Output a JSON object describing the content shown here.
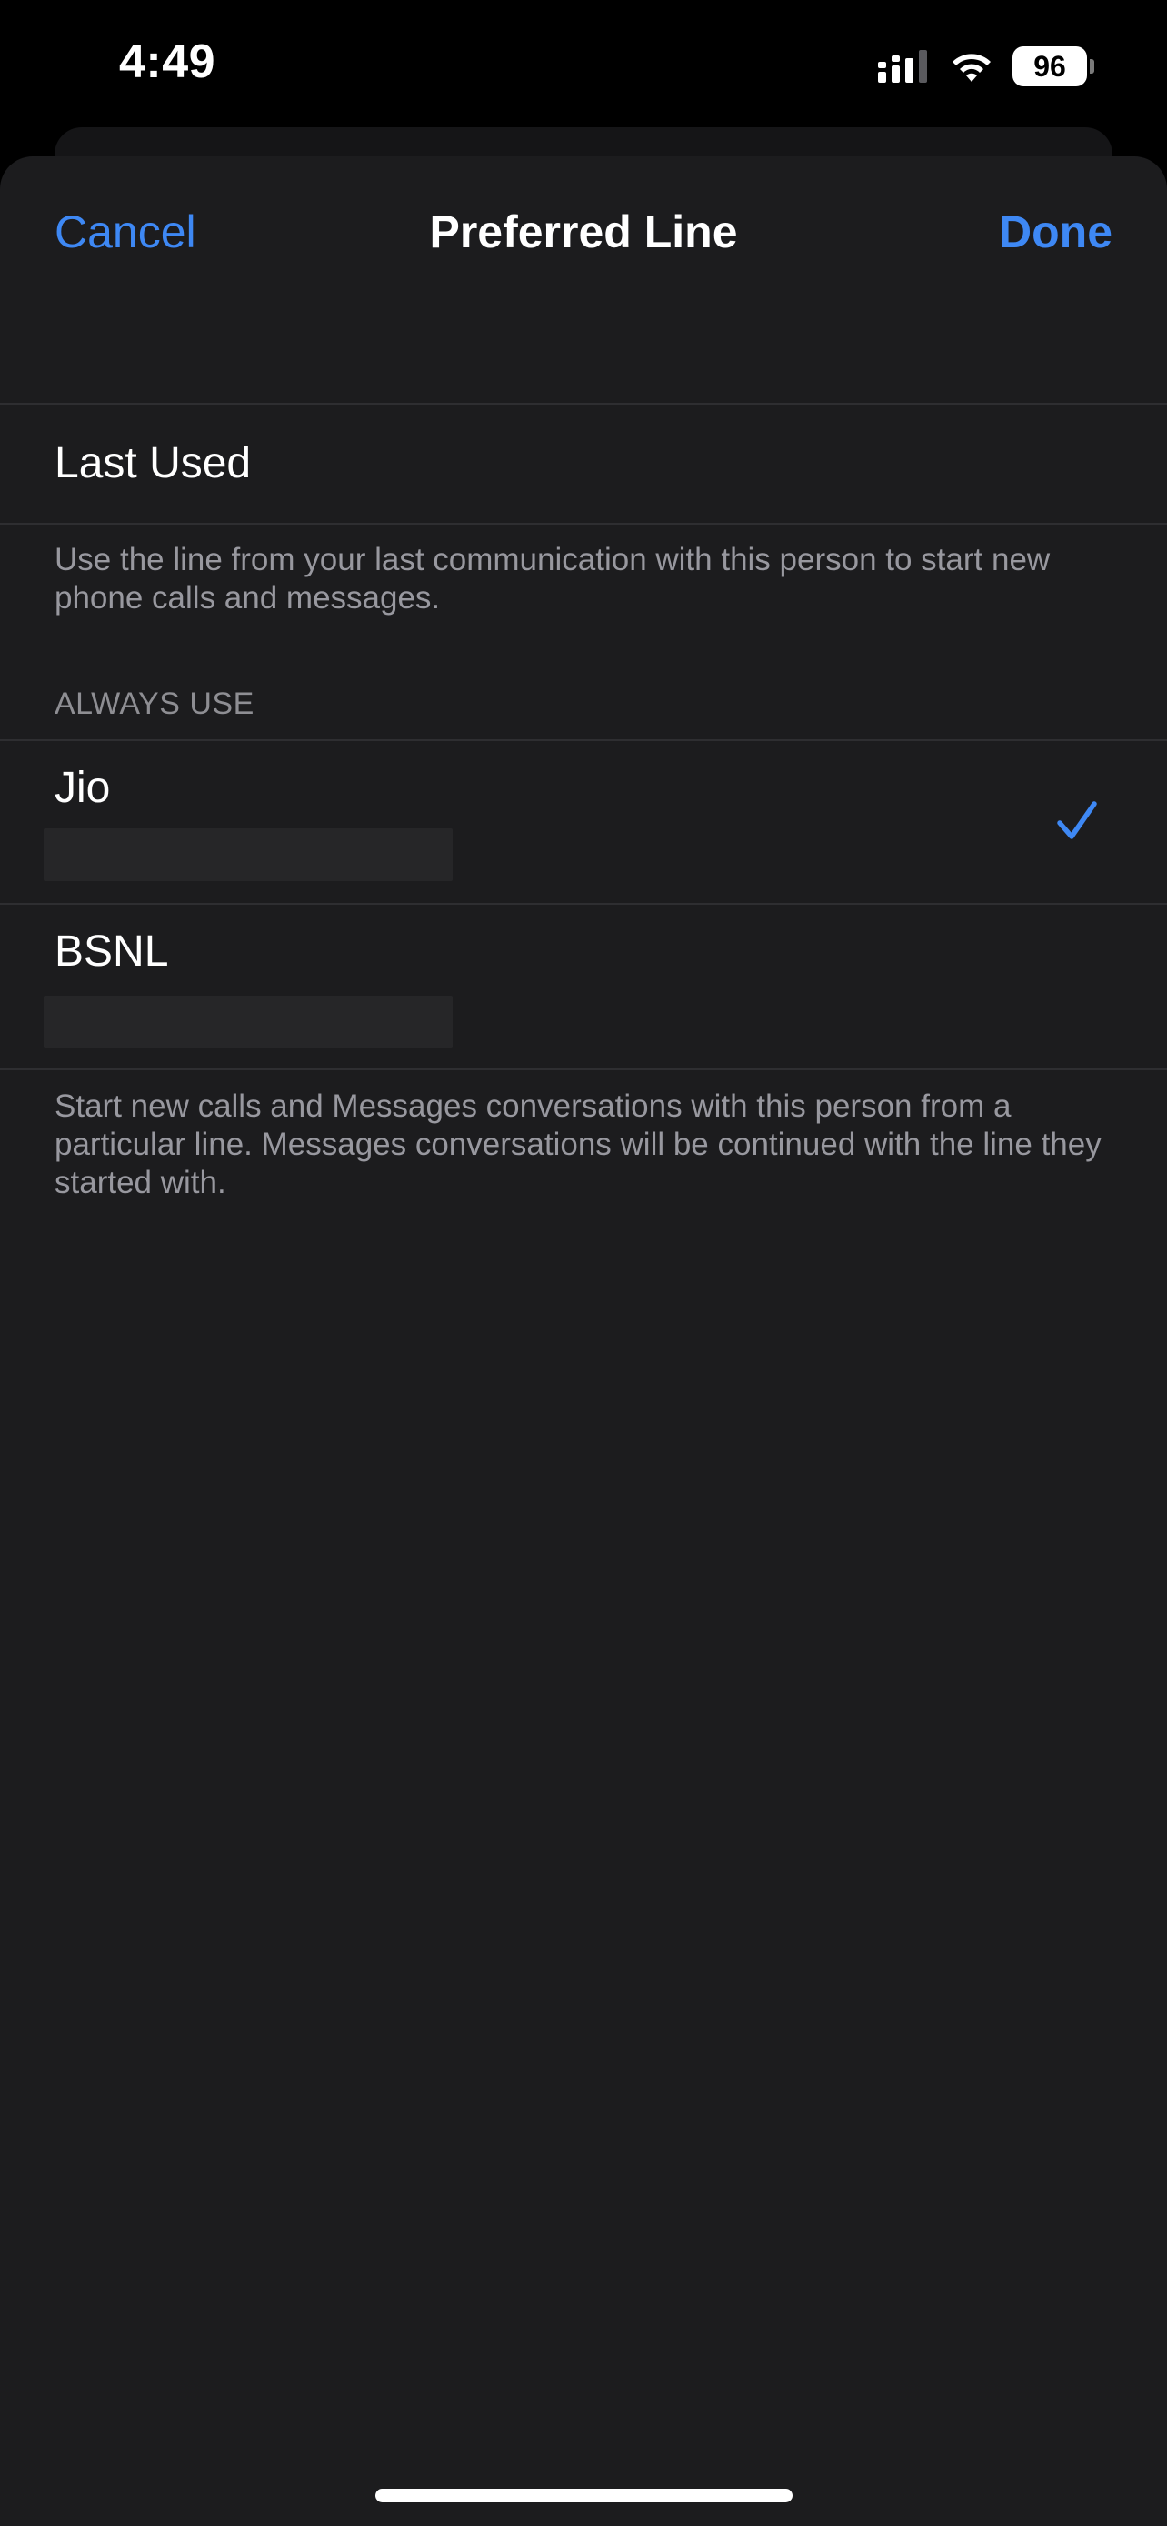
{
  "status_bar": {
    "time": "4:49",
    "battery_level": "96",
    "icons": [
      "cellular-signal-icon",
      "wifi-icon",
      "battery-icon"
    ]
  },
  "nav": {
    "cancel_label": "Cancel",
    "title": "Preferred Line",
    "done_label": "Done"
  },
  "last_used": {
    "label": "Last Used",
    "footer": "Use the line from your last communication with this person to start new phone calls and messages."
  },
  "always_use": {
    "header": "ALWAYS USE",
    "lines": [
      {
        "label": "Jio",
        "selected": true
      },
      {
        "label": "BSNL",
        "selected": false
      }
    ],
    "footer": "Start new calls and Messages conversations with this person from a particular line. Messages conversations will be continued with the line they started with."
  },
  "colors": {
    "accent": "#3e88f4",
    "sheet_background": "#1c1c1e",
    "separator": "#2e2e31",
    "secondary_text": "#98989f"
  }
}
